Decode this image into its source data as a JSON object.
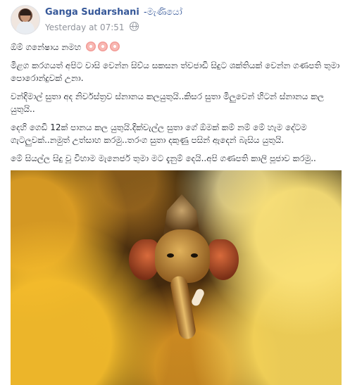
{
  "post": {
    "author": {
      "name": "Ganga Sudarshani",
      "suffix": "-මැණියෝ"
    },
    "timestamp": "Yesterday at 07:51",
    "audience_icon": "globe-icon",
    "paragraphs": [
      "ඕම් ගනේෂාය නමහ",
      "මිළග කරගයත් අපිට වාසි වෙන්න සිව්ය සකසන ත්වජාඩි සිදුට ශක්තියක් වෙන්න ගණපති තුමා පොරොන්දුවක් උනා.",
      "වන්දිමාල් සුතා අද නිර්වස්ත්‍රව ස්නානය කලයුතුයි..කිසර සුතා මිලුවෙන් හිටන් ස්නානය කල යුතුයි..",
      "දෙහි ගෙඩි 12ක් පානය කල යුතුයි.දික්වැල්ල සුතා ගේ ඕමක් කම් නම් මේ හැම දේටම ගැටලුවක්..නමුත් උත්සාහ කරමු..තරංග සුතා දකුණු පසින් ඇදෙන් බැසිය යුතුයි.",
      "මේ සියල්ල සිදු වූ විහාම මැනෙජර් තුමා මට දැනුම් දෙයි..අපි ගණපති කාලි පූජාව කරමු.."
    ],
    "emoji_icon": "cherry-blossom-icon",
    "emoji_count": 3,
    "colors": {
      "link": "#365899",
      "meta": "#90949c",
      "text": "#1d2129"
    }
  }
}
